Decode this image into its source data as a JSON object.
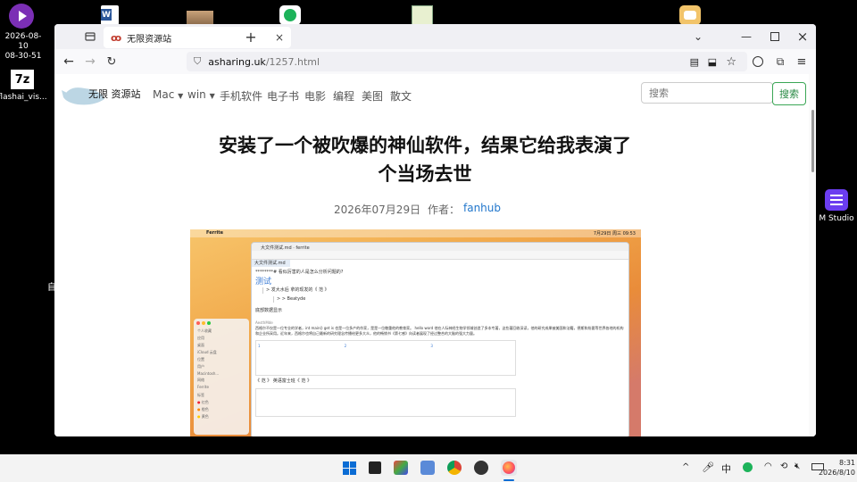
{
  "desktop": {
    "clock_date": "2026-08-10",
    "clock_time": "08-30-51",
    "icon_7z_label": "flashai_vis...",
    "icon_right_label": "M Studio",
    "side_chars": [
      "自"
    ]
  },
  "browser": {
    "tab_title": "无限资源站",
    "url_domain": "asharing.uk",
    "url_path": "/1257.html"
  },
  "site": {
    "logo_text": "无限 资源站",
    "nav": [
      "Mac",
      "win",
      "手机软件",
      "电子书",
      "电影",
      "编程",
      "美图",
      "散文"
    ],
    "search_placeholder": "搜索",
    "search_button": "搜索"
  },
  "article": {
    "title_line1": "安装了一个被吹爆的神仙软件，结果它给我表演了",
    "title_line2": "个当场去世",
    "date": "2026年07月29日",
    "author_label": "作者：",
    "author": "fanhub"
  },
  "screenshot": {
    "mac_app": "Ferrite",
    "mac_clock": "7月29日 周三 09:53",
    "doc_window_title": "大文件测试.md · ferrite",
    "doc_tab": "大文件测试.md",
    "line1": "********# 看似厉害的人是怎么分析问题的?",
    "heading": "测试",
    "quote1": "> 发大水后 拿的现发的《 范 》",
    "quote2": "> > Beatyde",
    "section": "底部数据显示",
    "small1": "AesthMde",
    "para": "西格尔不仅是一位专业的学者，int main() get is 也是一位多产的作家，是是一位敬重他的教育家。 hello word 他在人际神经生物学领域创造了多本专著，这些著回收深读，他的研究成果被美国和法籍，德斯和纷要等世界各地的机构和企业所采用。近年来，西格尔也将自己最新的研究理念传播给更多大众，他的畅销书《第七感》向读者展现了经过整合的大脑的强大力量。",
    "table_cols": [
      "1",
      "2",
      "3"
    ],
    "footer_line": "《 范 》 英语富士班《 范 》",
    "sidebar_items": [
      "个人收藏",
      "应用",
      "桌面",
      "iCloud 云盘",
      "位置",
      "用户",
      "Macintosh...",
      "网络",
      "Ferrite"
    ],
    "tags": [
      "标签",
      "红色",
      "橙色",
      "黄色"
    ]
  },
  "taskbar": {
    "ime": "中",
    "time": "8:31",
    "date": "2026/8/10"
  }
}
